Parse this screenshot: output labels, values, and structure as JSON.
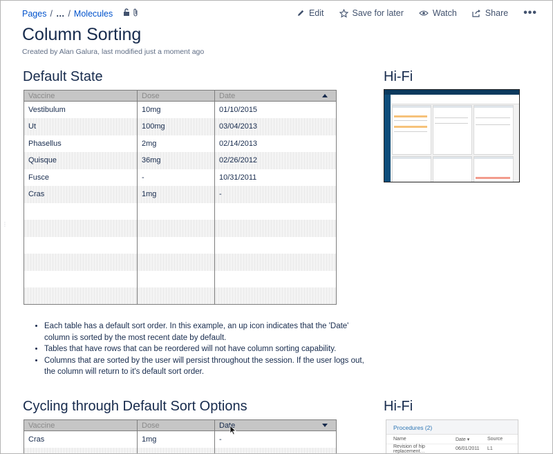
{
  "breadcrumb": {
    "pages": "Pages",
    "ellipsis": "…",
    "sep": "/",
    "current": "Molecules"
  },
  "actions": {
    "edit": "Edit",
    "save_for_later": "Save for later",
    "watch": "Watch",
    "share": "Share",
    "more": "•••"
  },
  "page": {
    "title": "Column Sorting",
    "byline": "Created by Alan Galura, last modified just a moment ago"
  },
  "section1": {
    "heading": "Default State",
    "hifi_heading": "Hi-Fi",
    "table": {
      "headers": [
        "Vaccine",
        "Dose",
        "Date"
      ],
      "sorted_column": "Date",
      "sort_direction": "up",
      "rows": [
        [
          "Vestibulum",
          "10mg",
          "01/10/2015"
        ],
        [
          "Ut",
          "100mg",
          "03/04/2013"
        ],
        [
          "Phasellus",
          "2mg",
          "02/14/2013"
        ],
        [
          "Quisque",
          "36mg",
          "02/26/2012"
        ],
        [
          "Fusce",
          "-",
          "10/31/2011"
        ],
        [
          "Cras",
          "1mg",
          "-"
        ],
        [
          "",
          "",
          ""
        ],
        [
          "",
          "",
          ""
        ],
        [
          "",
          "",
          ""
        ],
        [
          "",
          "",
          ""
        ],
        [
          "",
          "",
          ""
        ],
        [
          "",
          "",
          ""
        ]
      ]
    },
    "notes": [
      "Each table has a default sort order. In this example, an up icon indicates that the 'Date' column is sorted by the most recent date by default.",
      "Tables that have rows that can be reordered will not have column sorting capability.",
      "Columns that are sorted by the user will persist throughout the session. If the user logs out, the column will return to it's default sort order."
    ]
  },
  "section2": {
    "heading": "Cycling through Default Sort Options",
    "hifi_heading": "Hi-Fi",
    "table": {
      "headers": [
        "Vaccine",
        "Dose",
        "Date"
      ],
      "sorted_column": "Date",
      "sort_direction": "down",
      "rows": [
        [
          "Cras",
          "1mg",
          "-"
        ],
        [
          "",
          "",
          ""
        ]
      ]
    },
    "hifi_thumb": {
      "title": "Procedures (2)",
      "headers": [
        "Name",
        "Date ▾",
        "Source"
      ],
      "rows": [
        [
          "Revision of hip replacement…",
          "06/01/2011",
          "L1"
        ]
      ]
    }
  },
  "colors": {
    "link": "#0052cc",
    "text": "#172b4d",
    "header_bg": "#c6c6c6",
    "muted": "#5e6c84"
  }
}
